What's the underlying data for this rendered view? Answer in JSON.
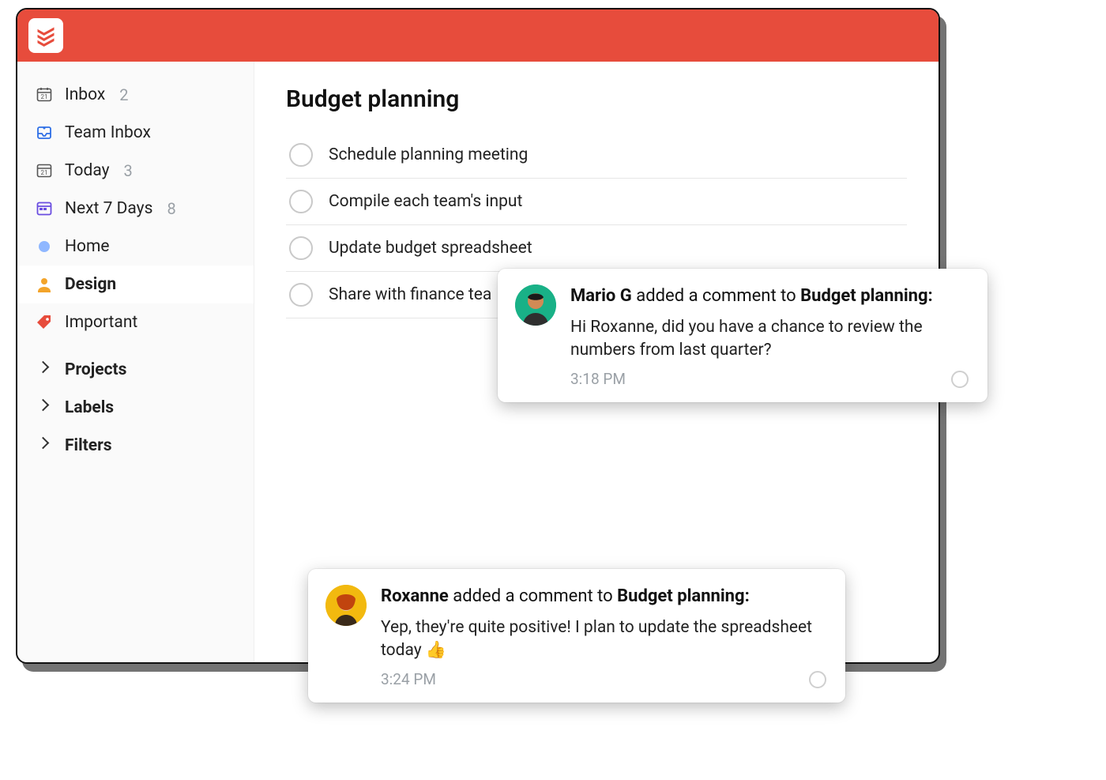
{
  "colors": {
    "brand_red": "#e74c3c",
    "muted": "#9aa0a6",
    "home_dot": "#8fb7ff",
    "person_icon": "#f3a42a",
    "tag_icon": "#e74c3c",
    "team_icon": "#2e6fe6",
    "next7_icon": "#6a4de0"
  },
  "sidebar": {
    "items": [
      {
        "key": "inbox",
        "label": "Inbox",
        "count": "2",
        "icon": "inbox-calendar-icon"
      },
      {
        "key": "team-inbox",
        "label": "Team Inbox",
        "count": "",
        "icon": "team-inbox-icon"
      },
      {
        "key": "today",
        "label": "Today",
        "count": "3",
        "icon": "today-icon"
      },
      {
        "key": "next7",
        "label": "Next 7 Days",
        "count": "8",
        "icon": "next7-icon"
      },
      {
        "key": "home",
        "label": "Home",
        "count": "",
        "icon": "dot-icon"
      },
      {
        "key": "design",
        "label": "Design",
        "count": "",
        "icon": "person-icon",
        "active": true
      },
      {
        "key": "important",
        "label": "Important",
        "count": "",
        "icon": "tag-icon"
      }
    ],
    "sections": [
      {
        "key": "projects",
        "label": "Projects"
      },
      {
        "key": "labels",
        "label": "Labels"
      },
      {
        "key": "filters",
        "label": "Filters"
      }
    ]
  },
  "main": {
    "title": "Budget planning",
    "tasks": [
      {
        "label": "Schedule planning meeting"
      },
      {
        "label": "Compile each team's input"
      },
      {
        "label": "Update budget spreadsheet"
      },
      {
        "label": "Share with finance tea"
      }
    ]
  },
  "notifications": [
    {
      "user": "Mario G",
      "action_mid": " added a comment to ",
      "target": "Budget planning:",
      "text": "Hi Roxanne, did you have a chance to review the numbers from last quarter?",
      "time": "3:18 PM",
      "avatar_bg": "#19b187",
      "emoji": ""
    },
    {
      "user": "Roxanne",
      "action_mid": " added a comment to ",
      "target": "Budget planning:",
      "text": "Yep, they're quite positive! I plan to update the spreadsheet today ",
      "time": "3:24 PM",
      "avatar_bg": "#f2b90f",
      "emoji": "👍"
    }
  ]
}
